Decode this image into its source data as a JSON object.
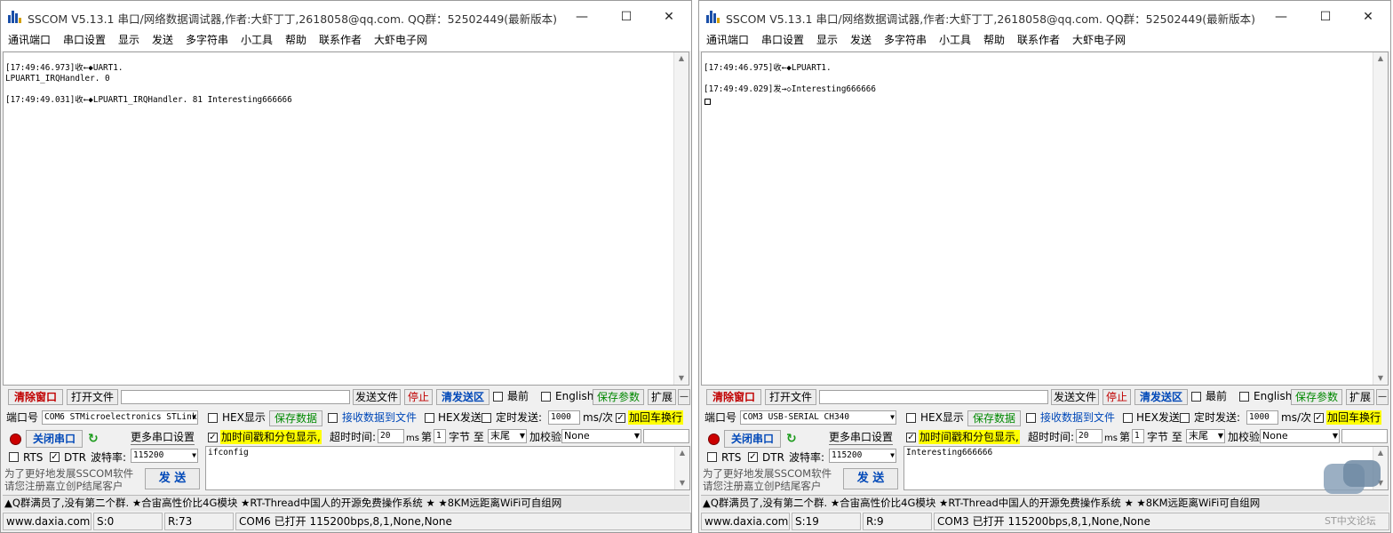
{
  "colors": {
    "highlight": "#ffff00",
    "red_button": "#c00000",
    "blue_button": "#0048b8",
    "green_text": "#008800"
  },
  "windows": [
    {
      "title": "SSCOM V5.13.1 串口/网络数据调试器,作者:大虾丁丁,2618058@qq.com. QQ群：52502449(最新版本)",
      "menu": [
        "通讯端口",
        "串口设置",
        "显示",
        "发送",
        "多字符串",
        "小工具",
        "帮助",
        "联系作者",
        "大虾电子网"
      ],
      "recv_lines": [
        "[17:49:46.973]收←◆UART1.",
        "LPUART1_IRQHandler. 0",
        "",
        "[17:49:49.031]收←◆LPUART1_IRQHandler. 81 Interesting666666"
      ],
      "show_cursor_box": false,
      "toolbar": {
        "clear": "清除窗口",
        "open_file": "打开文件",
        "send_file": "发送文件",
        "stop": "停止",
        "clear_send": "清发送区",
        "topmost": "最前",
        "english": "English",
        "save_params": "保存参数",
        "expand": "扩展",
        "minus": "—"
      },
      "port_label": "端口号",
      "port_value": "COM6 STMicroelectronics STLink",
      "hex_display": "HEX显示",
      "save_data": "保存数据",
      "recv_to_file": "接收数据到文件",
      "hex_send": "HEX发送",
      "timed_send": "定时发送:",
      "interval": "1000",
      "interval_unit": "ms/次",
      "add_crlf": "加回车换行",
      "close_port": "关闭串口",
      "more_settings": "更多串口设置",
      "timestamp": "加时间戳和分包显示,",
      "timeout_label": "超时时间:",
      "timeout": "20",
      "timeout_unit": "ms",
      "nth": "第",
      "byte_index": "1",
      "byte_label": "字节 至",
      "tail": "末尾",
      "checksum_label": "加校验",
      "checksum": "None",
      "rts": "RTS",
      "dtr": "DTR",
      "baud_label": "波特率:",
      "baud": "115200",
      "send_text": "ifconfig",
      "promo": "为了更好地发展SSCOM软件\n请您注册嘉立创P结尾客户",
      "promo_line1": "为了更好地发展SSCOM软件",
      "promo_line2": "请您注册嘉立创P结尾客户",
      "send_button": "发 送",
      "ad": "▲Q群满员了,没有第二个群. ★合宙高性价比4G模块 ★RT-Thread中国人的开源免费操作系统 ★ ★8KM远距离WiFi可自组网",
      "status": {
        "site": "www.daxia.com",
        "sent": "S:0",
        "recv": "R:73",
        "port": "COM6 已打开  115200bps,8,1,None,None"
      }
    },
    {
      "title": "SSCOM V5.13.1 串口/网络数据调试器,作者:大虾丁丁,2618058@qq.com. QQ群：52502449(最新版本)",
      "menu": [
        "通讯端口",
        "串口设置",
        "显示",
        "发送",
        "多字符串",
        "小工具",
        "帮助",
        "联系作者",
        "大虾电子网"
      ],
      "recv_lines": [
        "[17:49:46.975]收←◆LPUART1.",
        "",
        "[17:49:49.029]发→◇Interesting666666",
        ""
      ],
      "show_cursor_box": true,
      "toolbar": {
        "clear": "清除窗口",
        "open_file": "打开文件",
        "send_file": "发送文件",
        "stop": "停止",
        "clear_send": "清发送区",
        "topmost": "最前",
        "english": "English",
        "save_params": "保存参数",
        "expand": "扩展",
        "minus": "—"
      },
      "port_label": "端口号",
      "port_value": "COM3 USB-SERIAL CH340",
      "hex_display": "HEX显示",
      "save_data": "保存数据",
      "recv_to_file": "接收数据到文件",
      "hex_send": "HEX发送",
      "timed_send": "定时发送:",
      "interval": "1000",
      "interval_unit": "ms/次",
      "add_crlf": "加回车换行",
      "close_port": "关闭串口",
      "more_settings": "更多串口设置",
      "timestamp": "加时间戳和分包显示,",
      "timeout_label": "超时时间:",
      "timeout": "20",
      "timeout_unit": "ms",
      "nth": "第",
      "byte_index": "1",
      "byte_label": "字节 至",
      "tail": "末尾",
      "checksum_label": "加校验",
      "checksum": "None",
      "rts": "RTS",
      "dtr": "DTR",
      "baud_label": "波特率:",
      "baud": "115200",
      "send_text": "Interesting666666",
      "promo_line1": "为了更好地发展SSCOM软件",
      "promo_line2": "请您注册嘉立创P结尾客户",
      "send_button": "发 送",
      "ad": "▲Q群满员了,没有第二个群. ★合宙高性价比4G模块 ★RT-Thread中国人的开源免费操作系统 ★ ★8KM远距离WiFi可自组网",
      "status": {
        "site": "www.daxia.com",
        "sent": "S:19",
        "recv": "R:9",
        "port": "COM3 已打开  115200bps,8,1,None,None"
      }
    }
  ],
  "watermark": "ST中文论坛"
}
